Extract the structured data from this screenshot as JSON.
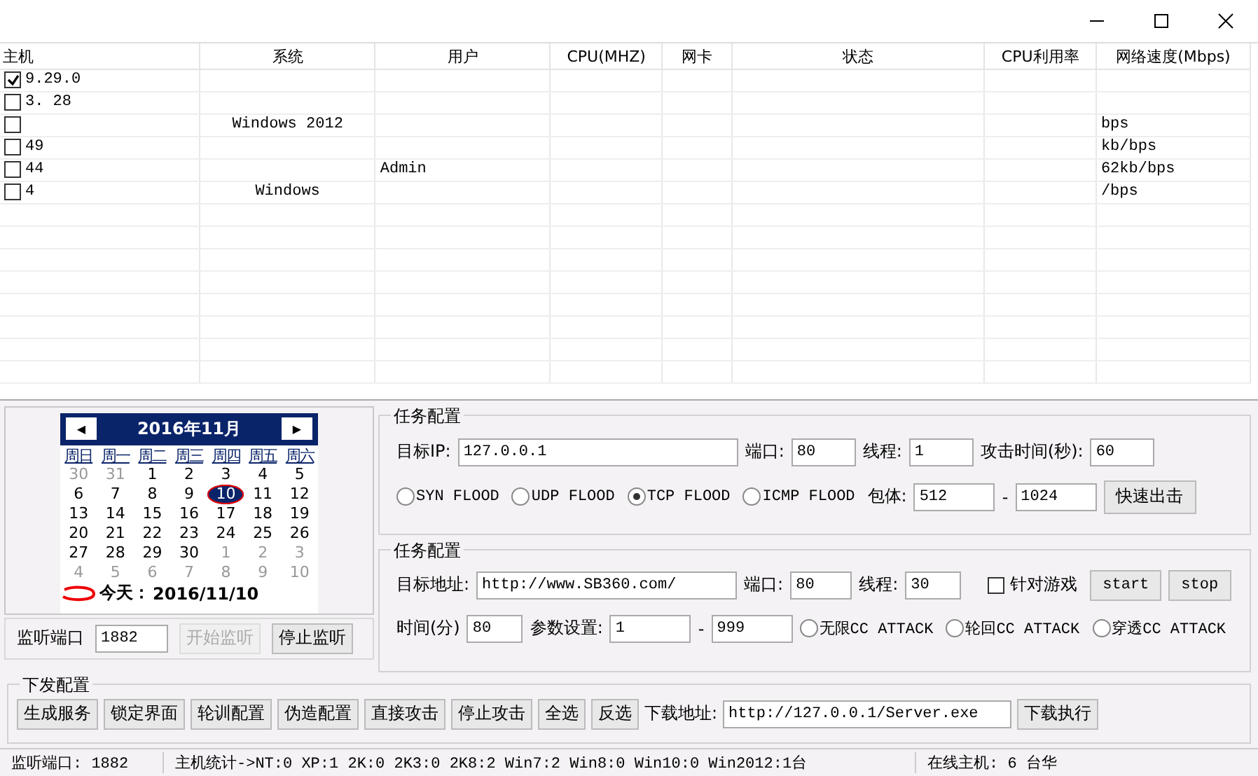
{
  "table": {
    "columns": [
      "主机",
      "系统",
      "用户",
      "CPU(MHZ)",
      "网卡",
      "状态",
      "CPU利用率",
      "网络速度(Mbps)"
    ],
    "rows": [
      {
        "checked": true,
        "cells": [
          "9.29.0",
          "",
          "",
          "",
          "",
          "",
          "",
          ""
        ]
      },
      {
        "checked": false,
        "cells": [
          "3.   28",
          "",
          "",
          "",
          "",
          "",
          "",
          ""
        ]
      },
      {
        "checked": false,
        "cells": [
          "",
          "Windows 2012",
          "",
          "",
          "",
          "",
          "",
          "bps"
        ]
      },
      {
        "checked": false,
        "cells": [
          "49",
          "",
          "",
          "",
          "",
          "",
          "",
          "kb/bps"
        ]
      },
      {
        "checked": false,
        "cells": [
          "44",
          "",
          "Admin",
          "",
          "",
          "",
          "",
          "62kb/bps"
        ]
      },
      {
        "checked": false,
        "cells": [
          "4",
          "Windows",
          "",
          "",
          "",
          "",
          "",
          "/bps"
        ]
      }
    ]
  },
  "calendar": {
    "title": "2016年11月",
    "prev": "◀",
    "next": "▶",
    "weekdays": [
      "周日",
      "周一",
      "周二",
      "周三",
      "周四",
      "周五",
      "周六"
    ],
    "days": [
      {
        "label": "30",
        "other": true,
        "selected": false
      },
      {
        "label": "31",
        "other": true,
        "selected": false
      },
      {
        "label": "1",
        "other": false,
        "selected": false
      },
      {
        "label": "2",
        "other": false,
        "selected": false
      },
      {
        "label": "3",
        "other": false,
        "selected": false
      },
      {
        "label": "4",
        "other": false,
        "selected": false
      },
      {
        "label": "5",
        "other": false,
        "selected": false
      },
      {
        "label": "6",
        "other": false,
        "selected": false
      },
      {
        "label": "7",
        "other": false,
        "selected": false
      },
      {
        "label": "8",
        "other": false,
        "selected": false
      },
      {
        "label": "9",
        "other": false,
        "selected": false
      },
      {
        "label": "10",
        "other": false,
        "selected": true
      },
      {
        "label": "11",
        "other": false,
        "selected": false
      },
      {
        "label": "12",
        "other": false,
        "selected": false
      },
      {
        "label": "13",
        "other": false,
        "selected": false
      },
      {
        "label": "14",
        "other": false,
        "selected": false
      },
      {
        "label": "15",
        "other": false,
        "selected": false
      },
      {
        "label": "16",
        "other": false,
        "selected": false
      },
      {
        "label": "17",
        "other": false,
        "selected": false
      },
      {
        "label": "18",
        "other": false,
        "selected": false
      },
      {
        "label": "19",
        "other": false,
        "selected": false
      },
      {
        "label": "20",
        "other": false,
        "selected": false
      },
      {
        "label": "21",
        "other": false,
        "selected": false
      },
      {
        "label": "22",
        "other": false,
        "selected": false
      },
      {
        "label": "23",
        "other": false,
        "selected": false
      },
      {
        "label": "24",
        "other": false,
        "selected": false
      },
      {
        "label": "25",
        "other": false,
        "selected": false
      },
      {
        "label": "26",
        "other": false,
        "selected": false
      },
      {
        "label": "27",
        "other": false,
        "selected": false
      },
      {
        "label": "28",
        "other": false,
        "selected": false
      },
      {
        "label": "29",
        "other": false,
        "selected": false
      },
      {
        "label": "30",
        "other": false,
        "selected": false
      },
      {
        "label": "1",
        "other": true,
        "selected": false
      },
      {
        "label": "2",
        "other": true,
        "selected": false
      },
      {
        "label": "3",
        "other": true,
        "selected": false
      },
      {
        "label": "4",
        "other": true,
        "selected": false
      },
      {
        "label": "5",
        "other": true,
        "selected": false
      },
      {
        "label": "6",
        "other": true,
        "selected": false
      },
      {
        "label": "7",
        "other": true,
        "selected": false
      },
      {
        "label": "8",
        "other": true,
        "selected": false
      },
      {
        "label": "9",
        "other": true,
        "selected": false
      },
      {
        "label": "10",
        "other": true,
        "selected": false
      }
    ],
    "today": "今天：",
    "today_date": "2016/11/10"
  },
  "listen": {
    "label": "监听端口",
    "value": "1882",
    "start": {
      "label": "开始监听",
      "disabled": true
    },
    "stop": {
      "label": "停止监听",
      "disabled": false
    }
  },
  "task1": {
    "title": "任务配置",
    "ip_label": "目标IP:",
    "ip": "127.0.0.1",
    "port_label": "端口:",
    "port": "80",
    "threads_label": "线程:",
    "threads": "1",
    "time_label": "攻击时间(秒):",
    "time": "60",
    "modes": [
      {
        "label": "SYN FLOOD",
        "selected": false
      },
      {
        "label": "UDP FLOOD",
        "selected": false
      },
      {
        "label": "TCP FLOOD",
        "selected": true
      },
      {
        "label": "ICMP FLOOD",
        "selected": false
      }
    ],
    "packet_label": "包体:",
    "packet_min": "512",
    "dash": "-",
    "packet_max": "1024",
    "button": "快速出击"
  },
  "task2": {
    "title": "任务配置",
    "url_label": "目标地址:",
    "url": "http://www.SB360.com/",
    "port_label": "端口:",
    "port": "80",
    "threads_label": "线程:",
    "threads": "30",
    "game": {
      "label": "针对游戏",
      "checked": false
    },
    "start": "start",
    "stop": "stop",
    "time_label": "时间(分)",
    "time": "80",
    "param_label": "参数设置:",
    "param_min": "1",
    "dash": "-",
    "param_max": "999",
    "modes": [
      {
        "label": "无限CC ATTACK",
        "selected": false
      },
      {
        "label": "轮回CC ATTACK",
        "selected": false
      },
      {
        "label": "穿透CC ATTACK",
        "selected": false
      }
    ]
  },
  "deploy": {
    "title": "下发配置",
    "buttons": [
      "生成服务",
      "锁定界面",
      "轮训配置",
      "伪造配置",
      "直接攻击",
      "停止攻击",
      "全选",
      "反选"
    ],
    "download_label": "下载地址:",
    "download_url": "http://127.0.0.1/Server.exe",
    "download_button": "下载执行"
  },
  "status_bar": {
    "port": "监听端口: 1882",
    "stats": "主机统计->NT:0  XP:1  2K:0  2K3:0  2K8:2  Win7:2  Win8:0 Win10:0 Win2012:1台",
    "online": "在线主机: 6 台华"
  }
}
